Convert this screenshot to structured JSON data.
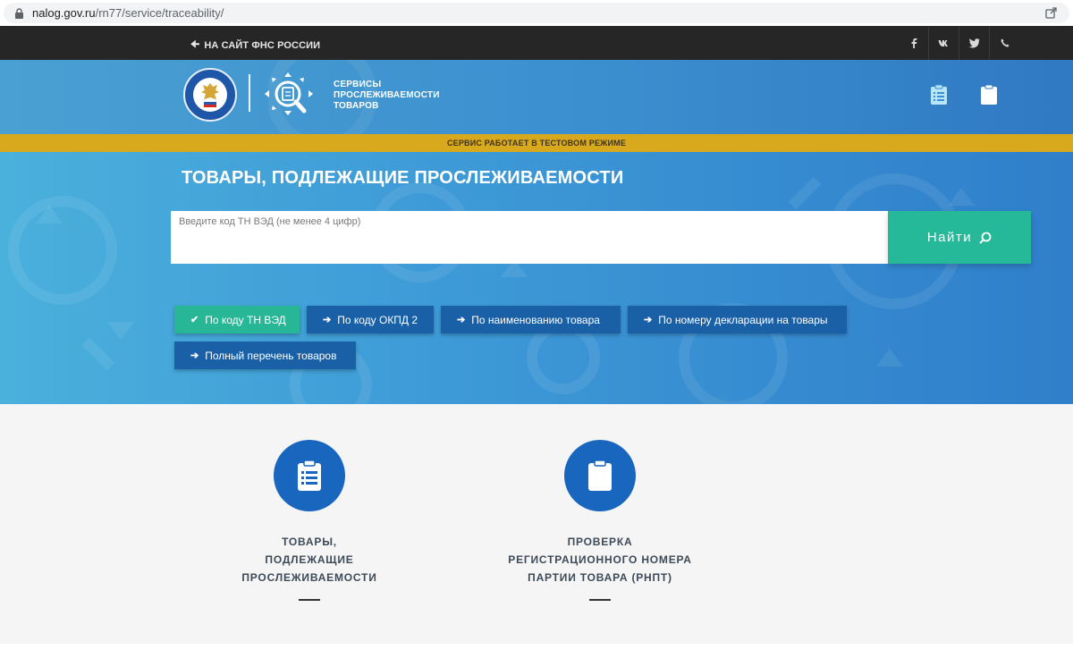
{
  "browser": {
    "url_domain": "nalog.gov.ru",
    "url_path": "/rn77/service/traceability/"
  },
  "topbar": {
    "back_label": "НА САЙТ ФНС РОССИИ",
    "socials": [
      "f",
      "vk",
      "twitter",
      "phone"
    ]
  },
  "header": {
    "logo_line1": "СЕРВИСЫ",
    "logo_line2": "ПРОСЛЕЖИВАЕМОСТИ",
    "logo_line3": "ТОВАРОВ"
  },
  "notice": "СЕРВИС РАБОТАЕТ В ТЕСТОВОМ РЕЖИМЕ",
  "hero": {
    "title": "ТОВАРЫ, ПОДЛЕЖАЩИЕ ПРОСЛЕЖИВАЕМОСТИ",
    "search_placeholder": "Введите код ТН ВЭД (не менее 4 цифр)",
    "search_value": "",
    "search_button": "Найти"
  },
  "filters": [
    {
      "label": "По коду ТН ВЭД",
      "active": true
    },
    {
      "label": "По коду ОКПД 2",
      "active": false
    },
    {
      "label": "По наименованию товара",
      "active": false
    },
    {
      "label": "По номеру декларации на товары",
      "active": false
    },
    {
      "label": "Полный перечень товаров",
      "active": false
    }
  ],
  "cards": [
    {
      "line1": "ТОВАРЫ,",
      "line2": "ПОДЛЕЖАЩИЕ",
      "line3": "ПРОСЛЕЖИВАЕМОСТИ",
      "icon": "clipboard-list-icon"
    },
    {
      "line1": "ПРОВЕРКА",
      "line2": "РЕГИСТРАЦИОННОГО НОМЕРА",
      "line3": "ПАРТИИ ТОВАРА (РНПТ)",
      "icon": "clipboard-icon"
    }
  ],
  "colors": {
    "accent_green": "#25b899",
    "button_blue": "#1960a6",
    "notice_yellow": "#d8a81d",
    "circle_blue": "#1866bd"
  }
}
